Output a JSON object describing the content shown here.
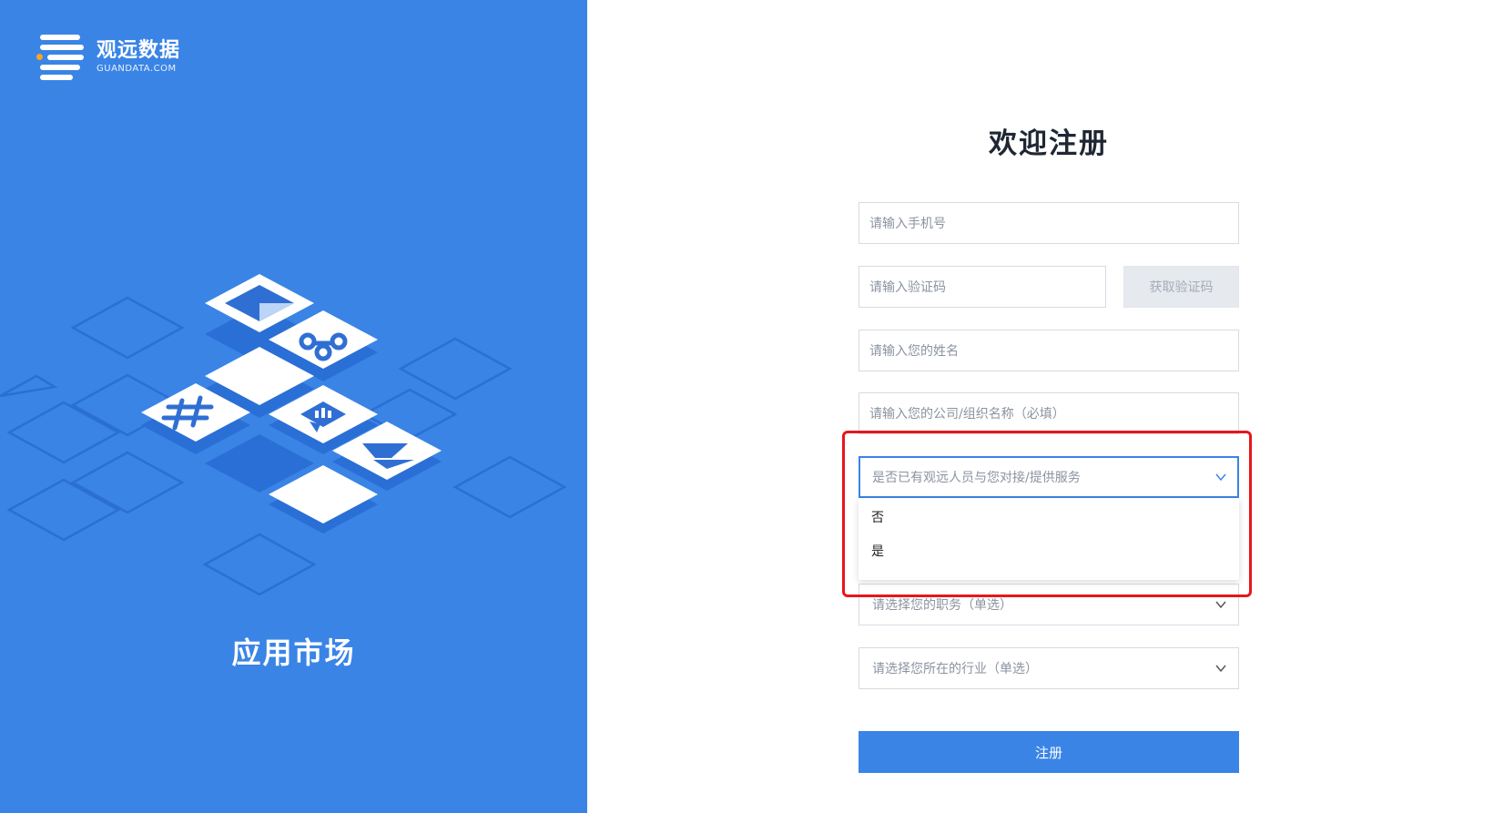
{
  "brand": {
    "name": "观远数据",
    "domain": "GUANDATA.COM",
    "accent_color": "#3a84e6",
    "dot_color": "#f5a623"
  },
  "left_panel": {
    "title": "应用市场"
  },
  "form": {
    "title": "欢迎注册",
    "phone_placeholder": "请输入手机号",
    "code_placeholder": "请输入验证码",
    "get_code_label": "获取验证码",
    "name_placeholder": "请输入您的姓名",
    "company_placeholder": "请输入您的公司/组织名称（必填）",
    "contact_select": {
      "placeholder": "是否已有观远人员与您对接/提供服务",
      "options": [
        "否",
        "是"
      ]
    },
    "position_select": {
      "placeholder": "请选择您的职务（单选）"
    },
    "industry_select": {
      "placeholder": "请选择您所在的行业（单选）"
    },
    "submit_label": "注册"
  },
  "annotation": {
    "highlight_color": "#e8161a"
  }
}
